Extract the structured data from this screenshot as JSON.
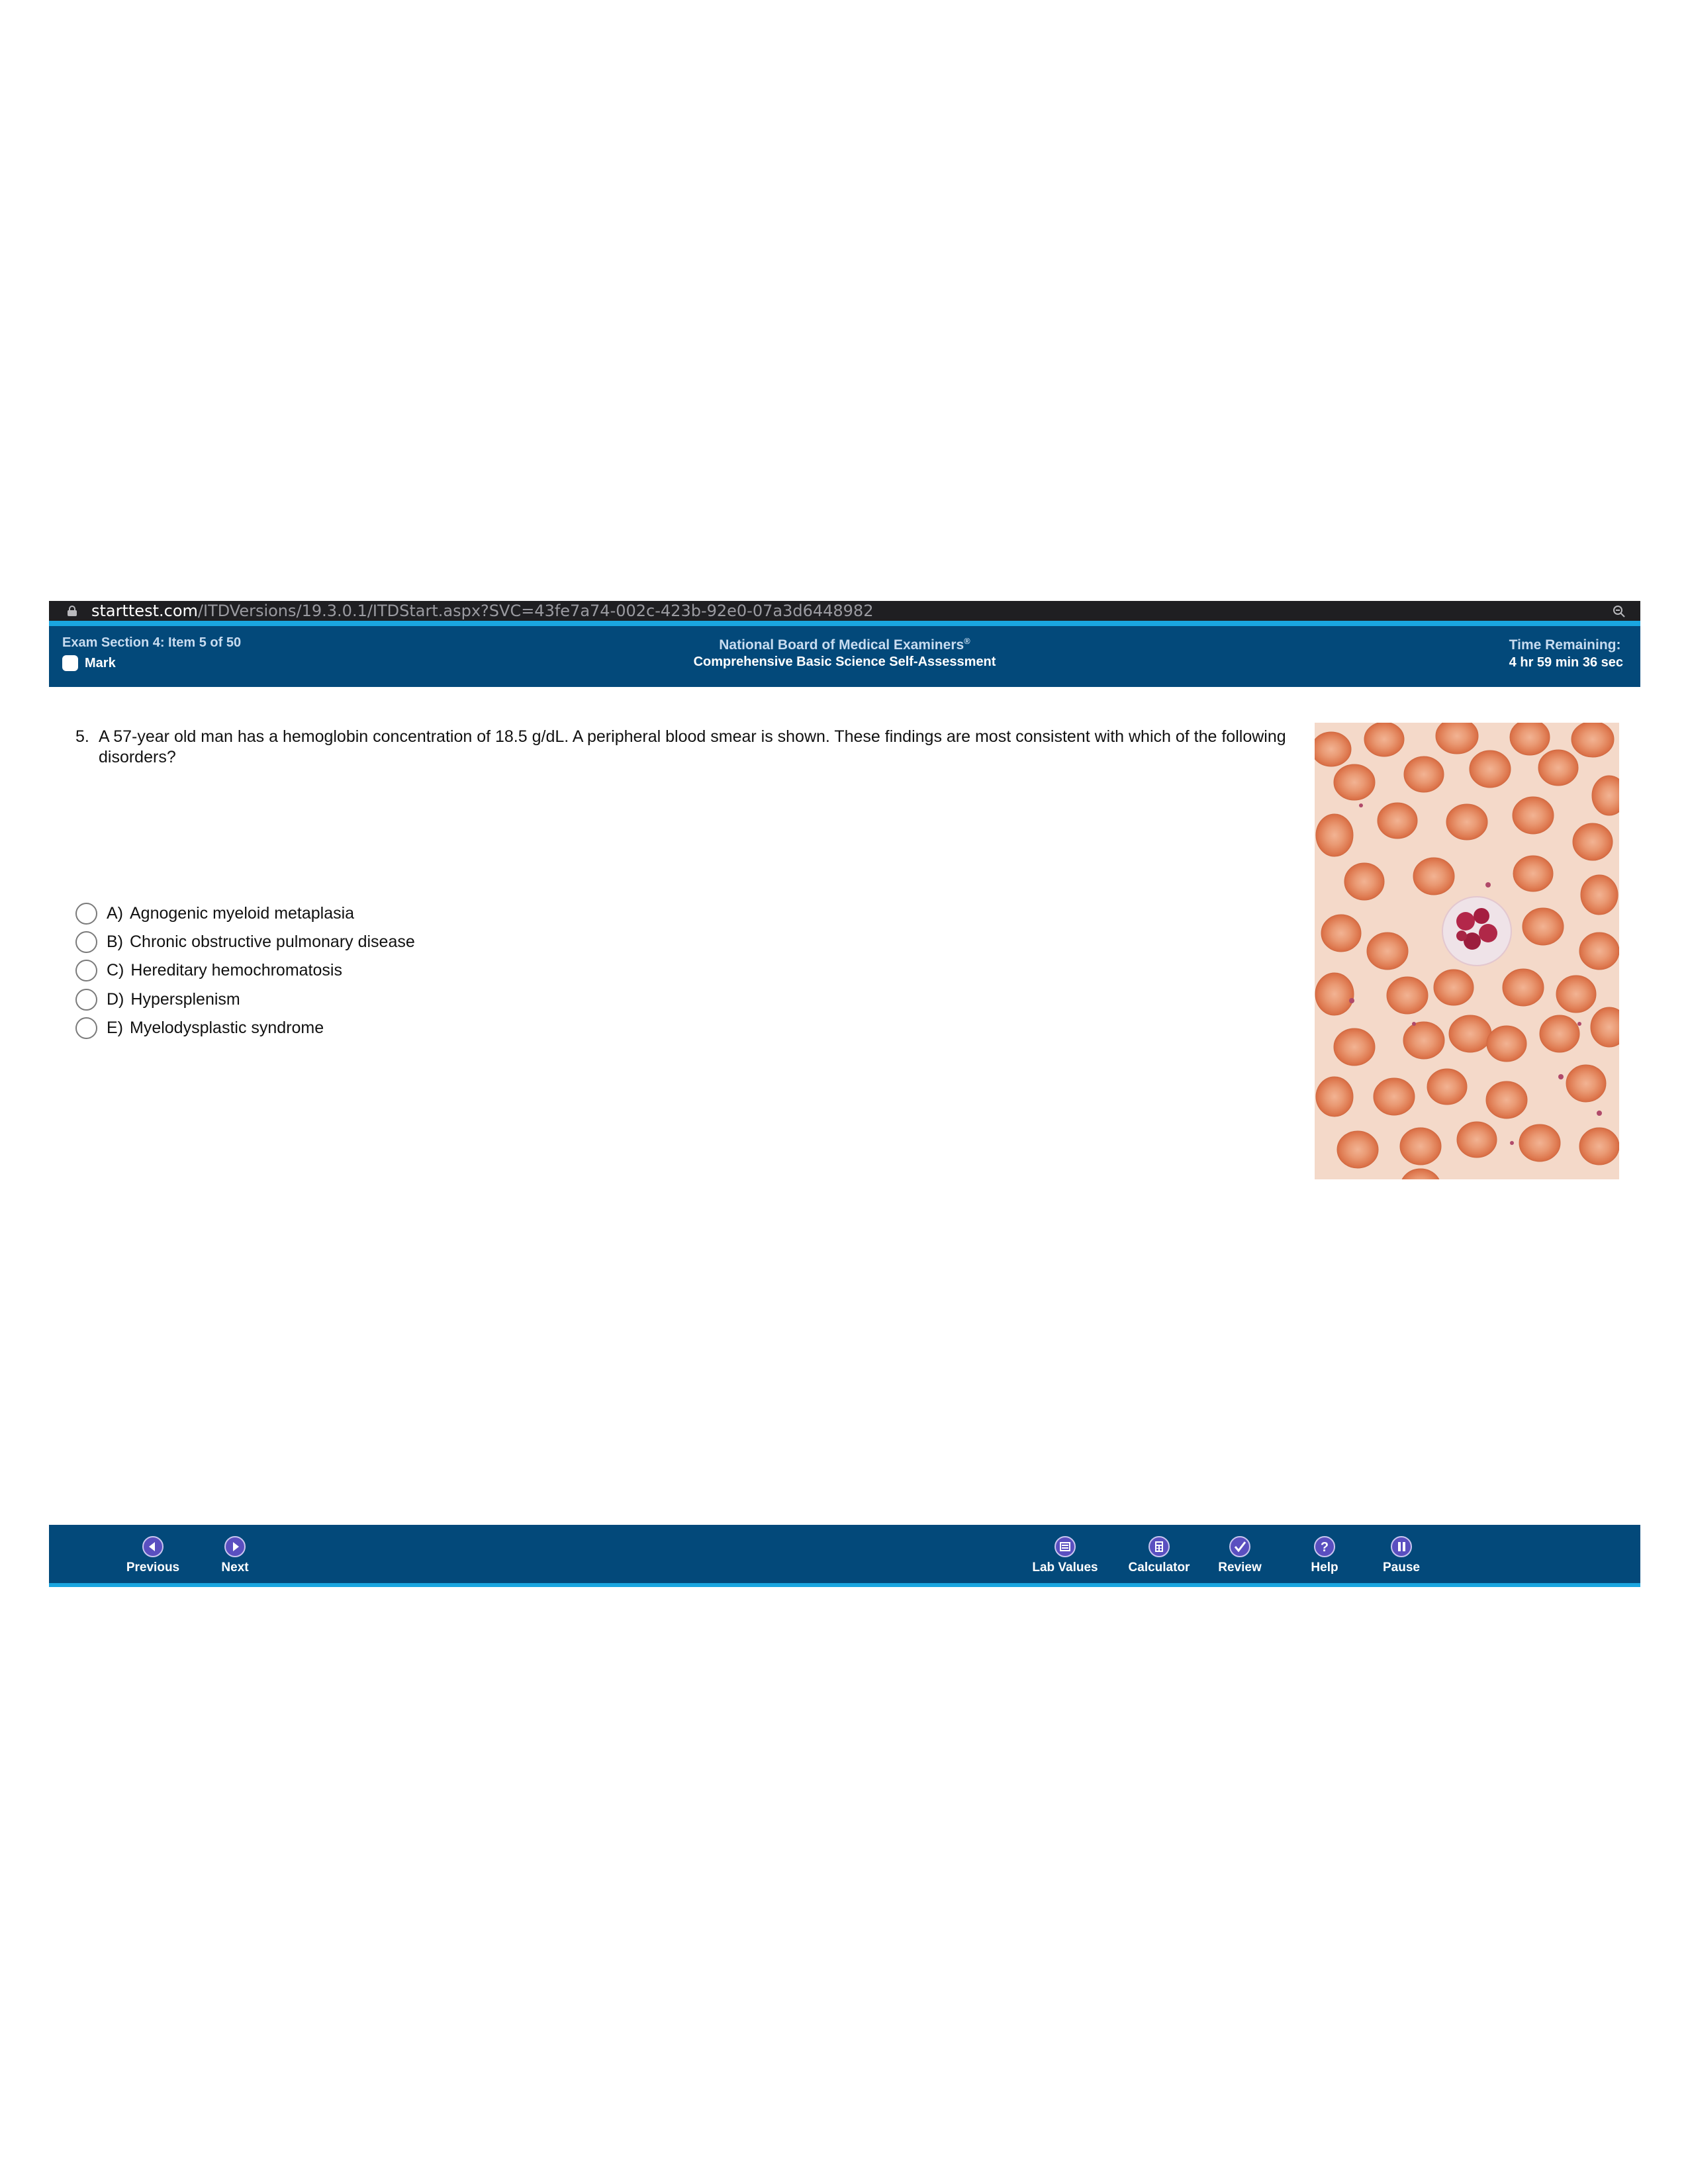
{
  "browser": {
    "url_host": "starttest.com",
    "url_path": "/ITDVersions/19.3.0.1/ITDStart.aspx?SVC=43fe7a74-002c-423b-92e0-07a3d6448982"
  },
  "header": {
    "section_item": "Exam Section 4: Item 5 of 50",
    "mark_label": "Mark",
    "organization": "National Board of Medical Examiners",
    "registered_mark": "®",
    "exam_title": "Comprehensive Basic Science Self-Assessment",
    "time_label": "Time Remaining:",
    "time_value": "4 hr 59 min 36 sec"
  },
  "question": {
    "number": "5.",
    "stem": "A 57-year old man has a hemoglobin concentration of 18.5 g/dL. A peripheral blood smear is shown. These findings are most consistent with which of the following disorders?",
    "options": [
      {
        "letter": "A)",
        "text": "Agnogenic myeloid metaplasia"
      },
      {
        "letter": "B)",
        "text": "Chronic obstructive pulmonary disease"
      },
      {
        "letter": "C)",
        "text": "Hereditary hemochromatosis"
      },
      {
        "letter": "D)",
        "text": "Hypersplenism"
      },
      {
        "letter": "E)",
        "text": "Myelodysplastic syndrome"
      }
    ]
  },
  "footer": {
    "previous": "Previous",
    "next": "Next",
    "lab_values": "Lab Values",
    "calculator": "Calculator",
    "review": "Review",
    "help": "Help",
    "pause": "Pause"
  },
  "colors": {
    "header_bg": "#03497a",
    "accent_stripe": "#1aa6e0",
    "urlbar_bg": "#1f1f22",
    "button_purple": "#5a4fc0",
    "rbc": "#e5835a",
    "smear_bg": "#f4d9c9"
  }
}
